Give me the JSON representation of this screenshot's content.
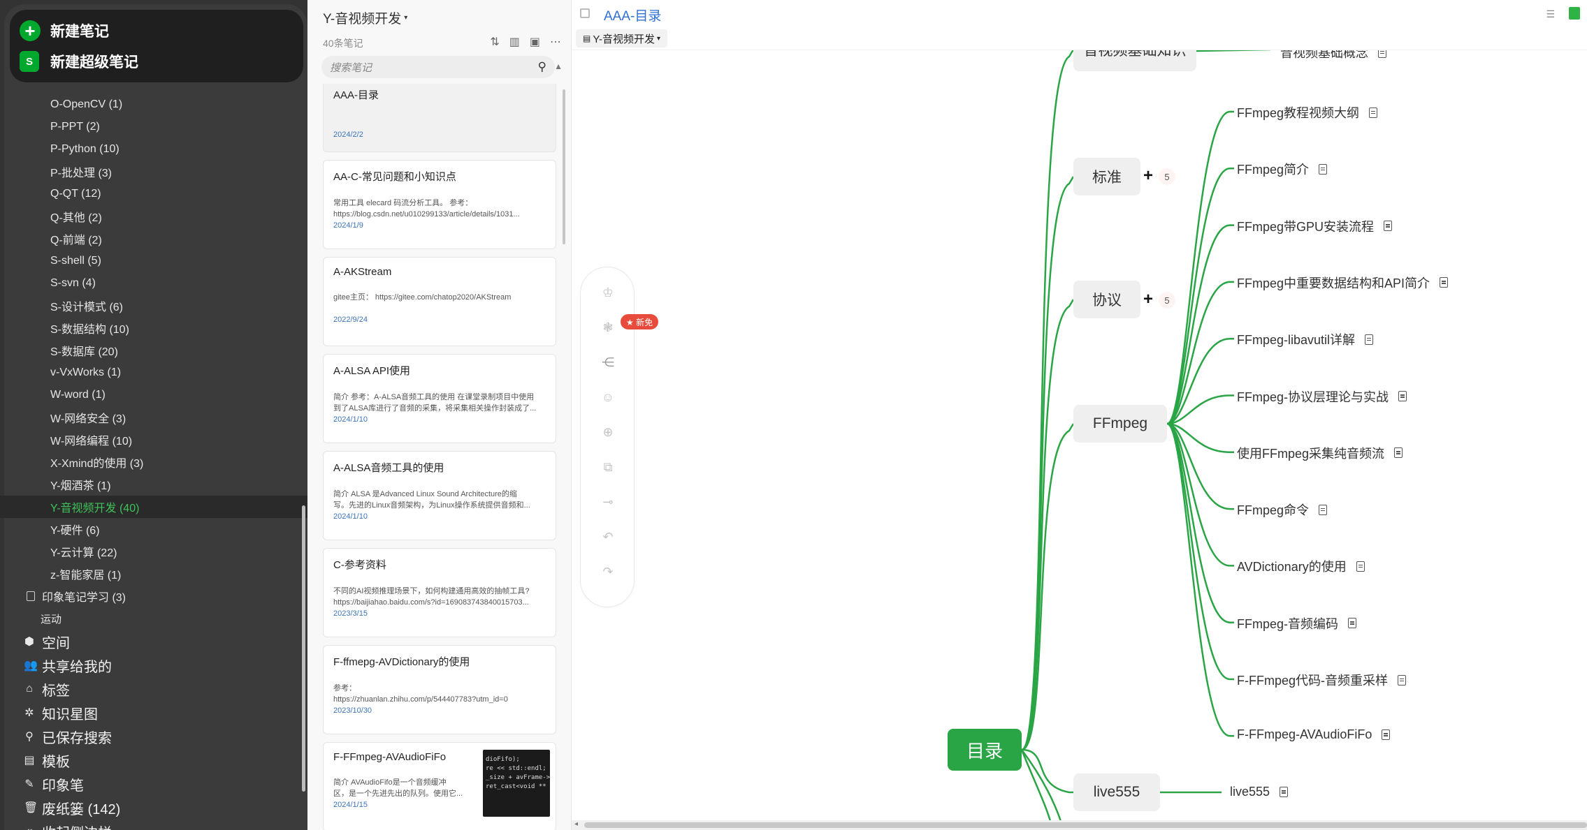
{
  "sidebar": {
    "new_note": "新建笔记",
    "new_super_note": "新建超级笔记",
    "super_icon_letter": "S",
    "notebooks": [
      {
        "label": "O-OpenCV  (1)"
      },
      {
        "label": "P-PPT  (2)"
      },
      {
        "label": "P-Python  (10)"
      },
      {
        "label": "P-批处理  (3)"
      },
      {
        "label": "Q-QT  (12)"
      },
      {
        "label": "Q-其他  (2)"
      },
      {
        "label": "Q-前端  (2)"
      },
      {
        "label": "S-shell  (5)"
      },
      {
        "label": "S-svn  (4)"
      },
      {
        "label": "S-设计模式  (6)"
      },
      {
        "label": "S-数据结构  (10)"
      },
      {
        "label": "S-数据库  (20)"
      },
      {
        "label": "v-VxWorks  (1)"
      },
      {
        "label": "W-word  (1)"
      },
      {
        "label": "W-网络安全  (3)"
      },
      {
        "label": "W-网络编程  (10)"
      },
      {
        "label": "X-Xmind的使用  (3)"
      },
      {
        "label": "Y-烟酒茶  (1)"
      },
      {
        "label": "Y-音视频开发  (40)"
      },
      {
        "label": "Y-硬件  (6)"
      },
      {
        "label": "Y-云计算  (22)"
      },
      {
        "label": "z-智能家居  (1)"
      }
    ],
    "stack": "印象笔记学习  (3)",
    "plain": "运动",
    "nav": [
      {
        "label": "空间",
        "icon": "cube-icon"
      },
      {
        "label": "共享给我的",
        "icon": "people-icon"
      },
      {
        "label": "标签",
        "icon": "tag-icon"
      },
      {
        "label": "知识星图",
        "icon": "graph-icon"
      },
      {
        "label": "已保存搜索",
        "icon": "search-icon"
      },
      {
        "label": "模板",
        "icon": "template-icon"
      },
      {
        "label": "印象笔",
        "icon": "pen-icon"
      },
      {
        "label": "废纸篓  (142)",
        "icon": "trash-icon"
      },
      {
        "label": "收起侧边栏",
        "icon": "collapse-icon"
      }
    ]
  },
  "notes": {
    "notebook_title": "Y-音视频开发",
    "count": "40条笔记",
    "search_placeholder": "搜索笔记",
    "cards": [
      {
        "title": "AAA-目录",
        "snippet": "",
        "date": "2024/2/2"
      },
      {
        "title": "AA-C-常见问题和小知识点",
        "snippet": "常用工具 elecard 码流分析工具。 参考：\nhttps://blog.csdn.net/u010299133/article/details/1031...",
        "date": "2024/1/9"
      },
      {
        "title": "A-AKStream",
        "snippet": "gitee主页： https://gitee.com/chatop2020/AKStream",
        "date": "2022/9/24"
      },
      {
        "title": "A-ALSA API使用",
        "snippet": "简介 参考：A-ALSA音频工具的使用 在课堂录制项目中使用\n到了ALSA库进行了音频的采集，将采集相关操作封装成了...",
        "date": "2024/1/10"
      },
      {
        "title": "A-ALSA音频工具的使用",
        "snippet": "简介 ALSA 是Advanced Linux Sound Architecture的缩\n写。先进的Linux音频架构，为Linux操作系统提供音频和...",
        "date": "2024/1/10"
      },
      {
        "title": "C-参考资料",
        "snippet": "不同的AI视频推理场景下，如何构建通用高效的抽帧工具?\nhttps://baijiahao.baidu.com/s?id=169083743840015703...",
        "date": "2023/3/15"
      },
      {
        "title": "F-ffmepg-AVDictionary的使用",
        "snippet": "参考：\nhttps://zhuanlan.zhihu.com/p/544407783?utm_id=0",
        "date": "2023/10/30"
      },
      {
        "title": "F-FFmpeg-AVAudioFiFo",
        "snippet": "简介 AVAudioFifo是一个音频缓冲\n区，是一个先进先出的队列。使用它...",
        "date": "2024/1/15"
      }
    ],
    "thumb_code": "dioFifo);\nre << std::endl;\n_size + avFrame->\nret_cast<void **"
  },
  "editor": {
    "note_title": "AAA-目录",
    "notebook_selector": "Y-音视频开发",
    "badge": "★ 新免",
    "mindmap": {
      "root": "目录",
      "top_partial": "音视频基础知识",
      "top_partial_leaf": "音视频基础概念",
      "branches": [
        {
          "label": "标准",
          "collapsed_count": "5"
        },
        {
          "label": "协议",
          "collapsed_count": "5"
        },
        {
          "label": "FFmpeg"
        },
        {
          "label": "live555"
        }
      ],
      "ffmpeg_children": [
        "FFmpeg教程视频大纲",
        "FFmpeg简介",
        "FFmpeg带GPU安装流程",
        "FFmpeg中重要数据结构和API简介",
        "FFmpeg-libavutil详解",
        "FFmpeg-协议层理论与实战",
        "使用FFmpeg采集纯音频流",
        "FFmpeg命令",
        "AVDictionary的使用",
        "FFmpeg-音频编码",
        "F-FFmpeg代码-音频重采样",
        "F-FFmpeg-AVAudioFiFo"
      ],
      "live555_child": "live555"
    },
    "colors": {
      "branch": "#2aa545",
      "link": "#2d6fd3",
      "active_notebook": "#3ec259"
    }
  }
}
